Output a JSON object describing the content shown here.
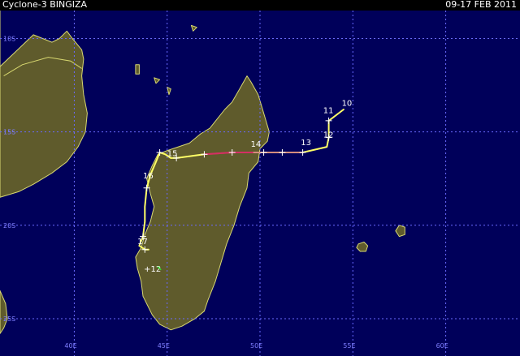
{
  "header": {
    "title": "Cyclone-3 BINGIZA",
    "dates": "09-17 FEB 2011"
  },
  "map": {
    "projection": "lon-lat",
    "lon_range": [
      36,
      64
    ],
    "lat_range": [
      -27,
      -8.5
    ],
    "ocean_color": "#00005a",
    "land_color": "#5f5b2c",
    "coast_color": "#d8d870",
    "grid_color": "#6a6aff",
    "lon_ticks": [
      {
        "value": 40,
        "label": "40E"
      },
      {
        "value": 45,
        "label": "45E"
      },
      {
        "value": 50,
        "label": "50E"
      },
      {
        "value": 55,
        "label": "55E"
      },
      {
        "value": 60,
        "label": "60E"
      }
    ],
    "lat_ticks": [
      {
        "value": -10,
        "label": "10S"
      },
      {
        "value": -15,
        "label": "15S"
      },
      {
        "value": -20,
        "label": "20S"
      },
      {
        "value": -25,
        "label": "25S"
      }
    ]
  },
  "track": {
    "segments": [
      {
        "intensity": "tropical storm",
        "color": "#ffff66",
        "points": [
          [
            54.5,
            -13.8
          ],
          [
            53.7,
            -14.4
          ],
          [
            53.7,
            -15.3
          ],
          [
            53.6,
            -15.8
          ],
          [
            52.3,
            -16.1
          ],
          [
            51.2,
            -16.1
          ],
          [
            50.2,
            -16.1
          ],
          [
            49.6,
            -16.1
          ]
        ]
      },
      {
        "intensity": "category 1",
        "color": "#ff3030",
        "points": [
          [
            49.6,
            -16.1
          ],
          [
            48.5,
            -16.1
          ],
          [
            47.0,
            -16.2
          ]
        ]
      },
      {
        "intensity": "tropical storm",
        "color": "#ffff66",
        "points": [
          [
            47.0,
            -16.2
          ],
          [
            45.5,
            -16.4
          ],
          [
            45.2,
            -16.4
          ],
          [
            44.9,
            -16.2
          ],
          [
            44.6,
            -16.1
          ],
          [
            44.4,
            -16.6
          ],
          [
            44.1,
            -17.3
          ],
          [
            43.9,
            -18.0
          ],
          [
            43.8,
            -19.0
          ],
          [
            43.8,
            -19.8
          ],
          [
            43.7,
            -20.6
          ],
          [
            43.5,
            -21.1
          ],
          [
            43.8,
            -21.3
          ],
          [
            44.0,
            -21.3
          ]
        ]
      }
    ],
    "day_labels": [
      {
        "label": "10",
        "lon": 54.4,
        "lat": -13.6
      },
      {
        "label": "11",
        "lon": 53.4,
        "lat": -14.0
      },
      {
        "label": "12",
        "lon": 53.4,
        "lat": -15.3
      },
      {
        "label": "13",
        "lon": 52.2,
        "lat": -15.7
      },
      {
        "label": "14",
        "lon": 49.5,
        "lat": -15.8
      },
      {
        "label": "15",
        "lon": 45.0,
        "lat": -16.3
      },
      {
        "label": "16",
        "lon": 43.7,
        "lat": -17.5
      },
      {
        "label": "17",
        "lon": 43.4,
        "lat": -21.0
      }
    ],
    "hour_ticks": [
      [
        53.7,
        -14.4
      ],
      [
        53.7,
        -15.3
      ],
      [
        52.3,
        -16.1
      ],
      [
        51.2,
        -16.1
      ],
      [
        50.2,
        -16.1
      ],
      [
        48.5,
        -16.1
      ],
      [
        47.0,
        -16.2
      ],
      [
        45.5,
        -16.4
      ],
      [
        44.6,
        -16.1
      ],
      [
        43.9,
        -18.0
      ],
      [
        43.7,
        -20.6
      ],
      [
        43.8,
        -21.3
      ]
    ],
    "current_position": {
      "label": "+12",
      "lon": 44.1,
      "lat": -22.3
    }
  },
  "land": {
    "africa": [
      [
        36,
        -11.5
      ],
      [
        37.8,
        -9.8
      ],
      [
        38.8,
        -10.2
      ],
      [
        39.2,
        -10.0
      ],
      [
        39.6,
        -9.6
      ],
      [
        39.9,
        -10.0
      ],
      [
        40.4,
        -10.6
      ],
      [
        40.5,
        -11.1
      ],
      [
        40.4,
        -12.0
      ],
      [
        40.5,
        -13.0
      ],
      [
        40.7,
        -14.0
      ],
      [
        40.6,
        -15.0
      ],
      [
        40.2,
        -15.8
      ],
      [
        39.6,
        -16.6
      ],
      [
        38.8,
        -17.2
      ],
      [
        37.8,
        -17.8
      ],
      [
        37.0,
        -18.2
      ],
      [
        36.0,
        -18.5
      ]
    ],
    "madagascar": [
      [
        49.3,
        -12.0
      ],
      [
        49.5,
        -12.3
      ],
      [
        49.9,
        -13.0
      ],
      [
        50.2,
        -14.0
      ],
      [
        50.5,
        -15.0
      ],
      [
        50.4,
        -15.5
      ],
      [
        50.0,
        -15.9
      ],
      [
        49.9,
        -16.6
      ],
      [
        49.4,
        -17.2
      ],
      [
        49.3,
        -18.0
      ],
      [
        48.9,
        -19.0
      ],
      [
        48.6,
        -20.0
      ],
      [
        48.2,
        -21.0
      ],
      [
        47.9,
        -22.0
      ],
      [
        47.6,
        -23.0
      ],
      [
        47.2,
        -24.0
      ],
      [
        47.0,
        -24.6
      ],
      [
        46.5,
        -25.0
      ],
      [
        45.8,
        -25.4
      ],
      [
        45.2,
        -25.6
      ],
      [
        44.6,
        -25.3
      ],
      [
        44.2,
        -24.8
      ],
      [
        43.7,
        -23.8
      ],
      [
        43.6,
        -23.0
      ],
      [
        43.4,
        -22.3
      ],
      [
        43.3,
        -21.7
      ],
      [
        43.6,
        -21.2
      ],
      [
        43.8,
        -20.5
      ],
      [
        44.1,
        -19.8
      ],
      [
        44.3,
        -19.0
      ],
      [
        44.1,
        -18.3
      ],
      [
        43.9,
        -17.5
      ],
      [
        44.2,
        -16.8
      ],
      [
        44.5,
        -16.2
      ],
      [
        45.0,
        -16.0
      ],
      [
        45.6,
        -15.8
      ],
      [
        46.2,
        -15.6
      ],
      [
        46.8,
        -15.1
      ],
      [
        47.3,
        -14.8
      ],
      [
        47.7,
        -14.3
      ],
      [
        48.1,
        -13.8
      ],
      [
        48.5,
        -13.4
      ],
      [
        48.9,
        -12.7
      ]
    ],
    "mozambique_strip": [
      [
        36,
        -23.5
      ],
      [
        36.3,
        -24.2
      ],
      [
        36.4,
        -25.0
      ],
      [
        36.2,
        -25.5
      ],
      [
        36,
        -25.8
      ]
    ],
    "reunion": [
      [
        55.3,
        -21.0
      ],
      [
        55.6,
        -20.9
      ],
      [
        55.8,
        -21.1
      ],
      [
        55.7,
        -21.4
      ],
      [
        55.4,
        -21.4
      ],
      [
        55.2,
        -21.2
      ]
    ],
    "mauritius": [
      [
        57.5,
        -20.0
      ],
      [
        57.8,
        -20.1
      ],
      [
        57.8,
        -20.5
      ],
      [
        57.5,
        -20.6
      ],
      [
        57.3,
        -20.3
      ]
    ],
    "grande_comore": [
      [
        43.3,
        -11.4
      ],
      [
        43.5,
        -11.4
      ],
      [
        43.5,
        -11.9
      ],
      [
        43.3,
        -11.9
      ]
    ],
    "anjouan": [
      [
        44.3,
        -12.1
      ],
      [
        44.6,
        -12.2
      ],
      [
        44.4,
        -12.4
      ]
    ],
    "mayotte": [
      [
        45.0,
        -12.6
      ],
      [
        45.2,
        -12.7
      ],
      [
        45.1,
        -13.0
      ]
    ],
    "aldabra": [
      [
        46.3,
        -9.3
      ],
      [
        46.6,
        -9.4
      ],
      [
        46.4,
        -9.6
      ]
    ]
  }
}
